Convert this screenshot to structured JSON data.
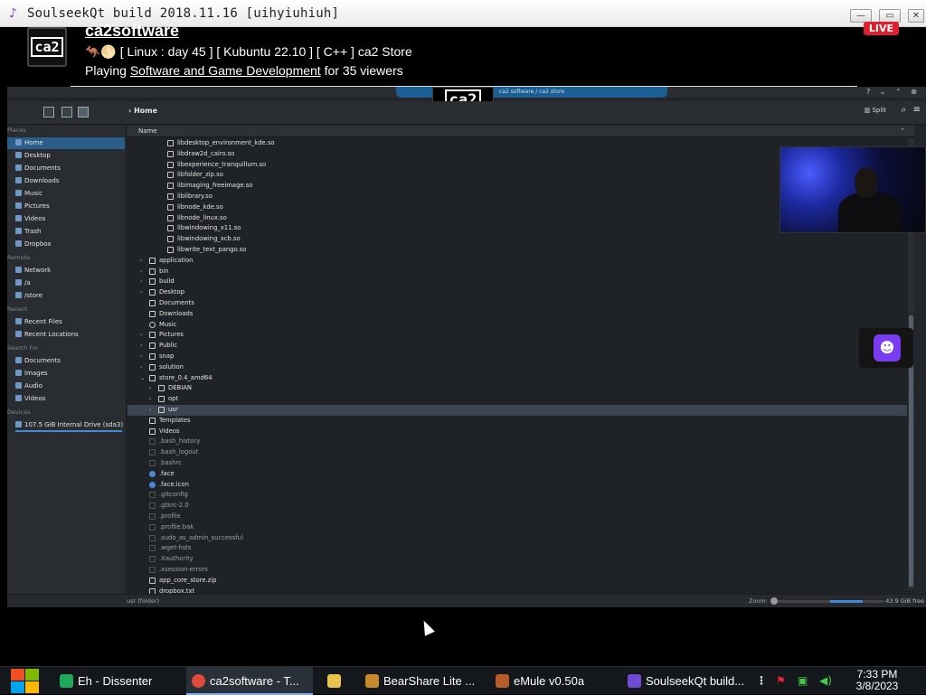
{
  "window": {
    "title": "SoulseekQt build 2018.11.16 [uihyiuhiuh]",
    "minimize": "—",
    "maximize": "▭",
    "close": "✕"
  },
  "stream": {
    "logo_text": "ca2",
    "channel_name": "ca2software",
    "title": "🦘🌕 [ Linux : day 45 ] [ Kubuntu 22.10 ] [ C++ ] ca2 Store",
    "playing_prefix": "Playing ",
    "playing_game": "Software and Game Development",
    "playing_suffix": " for 35 viewers",
    "live_badge": "LIVE",
    "overlay_logo": "ca2"
  },
  "file_manager": {
    "top_tab": "ca2 software / ca2 store",
    "window_controls": "? ⌄ ⌃ ⊗",
    "breadcrumb": "Home",
    "split_label": "Split",
    "column_name": "Name",
    "places": {
      "sections": [
        {
          "label": "Places",
          "items": [
            "Home",
            "Desktop",
            "Documents",
            "Downloads",
            "Music",
            "Pictures",
            "Videos",
            "Trash",
            "Dropbox"
          ]
        },
        {
          "label": "Remote",
          "items": [
            "Network",
            "/a",
            "/store"
          ]
        },
        {
          "label": "Recent",
          "items": [
            "Recent Files",
            "Recent Locations"
          ]
        },
        {
          "label": "Search For",
          "items": [
            "Documents",
            "Images",
            "Audio",
            "Videos"
          ]
        },
        {
          "label": "Devices",
          "items": [
            "107.5 GiB Internal Drive (sda3)"
          ]
        }
      ],
      "selected": "Home"
    },
    "rows": [
      {
        "name": "libdesktop_environment_kde.so",
        "level": 2,
        "type": "file"
      },
      {
        "name": "libdraw2d_cairo.so",
        "level": 2,
        "type": "file"
      },
      {
        "name": "libexperience_tranquillum.so",
        "level": 2,
        "type": "file"
      },
      {
        "name": "libfolder_zip.so",
        "level": 2,
        "type": "file"
      },
      {
        "name": "libimaging_freeimage.so",
        "level": 2,
        "type": "file"
      },
      {
        "name": "liblibrary.so",
        "level": 2,
        "type": "file"
      },
      {
        "name": "libnode_kde.so",
        "level": 2,
        "type": "file"
      },
      {
        "name": "libnode_linux.so",
        "level": 2,
        "type": "file"
      },
      {
        "name": "libwindowing_x11.so",
        "level": 2,
        "type": "file"
      },
      {
        "name": "libwindowing_xcb.so",
        "level": 2,
        "type": "file"
      },
      {
        "name": "libwrite_text_pango.so",
        "level": 2,
        "type": "file"
      },
      {
        "name": "application",
        "level": 0,
        "type": "folder",
        "arrow": "›"
      },
      {
        "name": "bin",
        "level": 0,
        "type": "folder",
        "arrow": "›"
      },
      {
        "name": "build",
        "level": 0,
        "type": "folder",
        "arrow": "›"
      },
      {
        "name": "Desktop",
        "level": 0,
        "type": "folder",
        "arrow": "›"
      },
      {
        "name": "Documents",
        "level": 0,
        "type": "folder"
      },
      {
        "name": "Downloads",
        "level": 0,
        "type": "folder"
      },
      {
        "name": "Music",
        "level": 0,
        "type": "music"
      },
      {
        "name": "Pictures",
        "level": 0,
        "type": "folder",
        "arrow": "›"
      },
      {
        "name": "Public",
        "level": 0,
        "type": "folder",
        "arrow": "›"
      },
      {
        "name": "snap",
        "level": 0,
        "type": "folder",
        "arrow": "›"
      },
      {
        "name": "solution",
        "level": 0,
        "type": "folder",
        "arrow": "›"
      },
      {
        "name": "store_0.4_amd64",
        "level": 0,
        "type": "folder",
        "arrow": "⌄"
      },
      {
        "name": "DEBIAN",
        "level": 1,
        "type": "folder",
        "arrow": "›"
      },
      {
        "name": "opt",
        "level": 1,
        "type": "folder",
        "arrow": "›"
      },
      {
        "name": "usr",
        "level": 1,
        "type": "folder",
        "arrow": "›",
        "selected": true
      },
      {
        "name": "Templates",
        "level": 0,
        "type": "folder"
      },
      {
        "name": "Videos",
        "level": 0,
        "type": "folder"
      },
      {
        "name": ".bash_history",
        "level": 0,
        "type": "hidden"
      },
      {
        "name": ".bash_logout",
        "level": 0,
        "type": "hidden"
      },
      {
        "name": ".bashrc",
        "level": 0,
        "type": "hidden"
      },
      {
        "name": ".face",
        "level": 0,
        "type": "face"
      },
      {
        "name": ".face.icon",
        "level": 0,
        "type": "face"
      },
      {
        "name": ".gitconfig",
        "level": 0,
        "type": "hidden"
      },
      {
        "name": ".gtkrc-2.0",
        "level": 0,
        "type": "hidden"
      },
      {
        "name": ".profile",
        "level": 0,
        "type": "hidden"
      },
      {
        "name": ".profile.bak",
        "level": 0,
        "type": "hidden"
      },
      {
        "name": ".sudo_as_admin_successful",
        "level": 0,
        "type": "hidden"
      },
      {
        "name": ".wget-hsts",
        "level": 0,
        "type": "hidden"
      },
      {
        "name": ".Xauthority",
        "level": 0,
        "type": "hidden"
      },
      {
        "name": ".xsession-errors",
        "level": 0,
        "type": "hidden"
      },
      {
        "name": "app_core_store.zip",
        "level": 0,
        "type": "file"
      },
      {
        "name": "dropbox.txt",
        "level": 0,
        "type": "file"
      }
    ],
    "status": {
      "selection": "usr (folder)",
      "zoom_label": "Zoom:",
      "free_space": "43.9 GiB free"
    }
  },
  "taskbar": {
    "items": [
      {
        "label": "Eh - Dissenter",
        "icon": "chat-bubble-icon",
        "color": "#1fa85a"
      },
      {
        "label": "ca2software - T...",
        "icon": "chrome-icon",
        "color": "#e04a3a",
        "active": true
      },
      {
        "label": "",
        "icon": "folder-icon",
        "color": "#e8c24a"
      },
      {
        "label": "BearShare Lite ...",
        "icon": "bear-icon",
        "color": "#c48a2a"
      },
      {
        "label": "eMule v0.50a",
        "icon": "mule-icon",
        "color": "#b55b2c"
      },
      {
        "label": "SoulseekQt build...",
        "icon": "soulseek-icon",
        "color": "#6e4bd0"
      }
    ],
    "time": "7:33 PM",
    "date": "3/8/2023"
  }
}
